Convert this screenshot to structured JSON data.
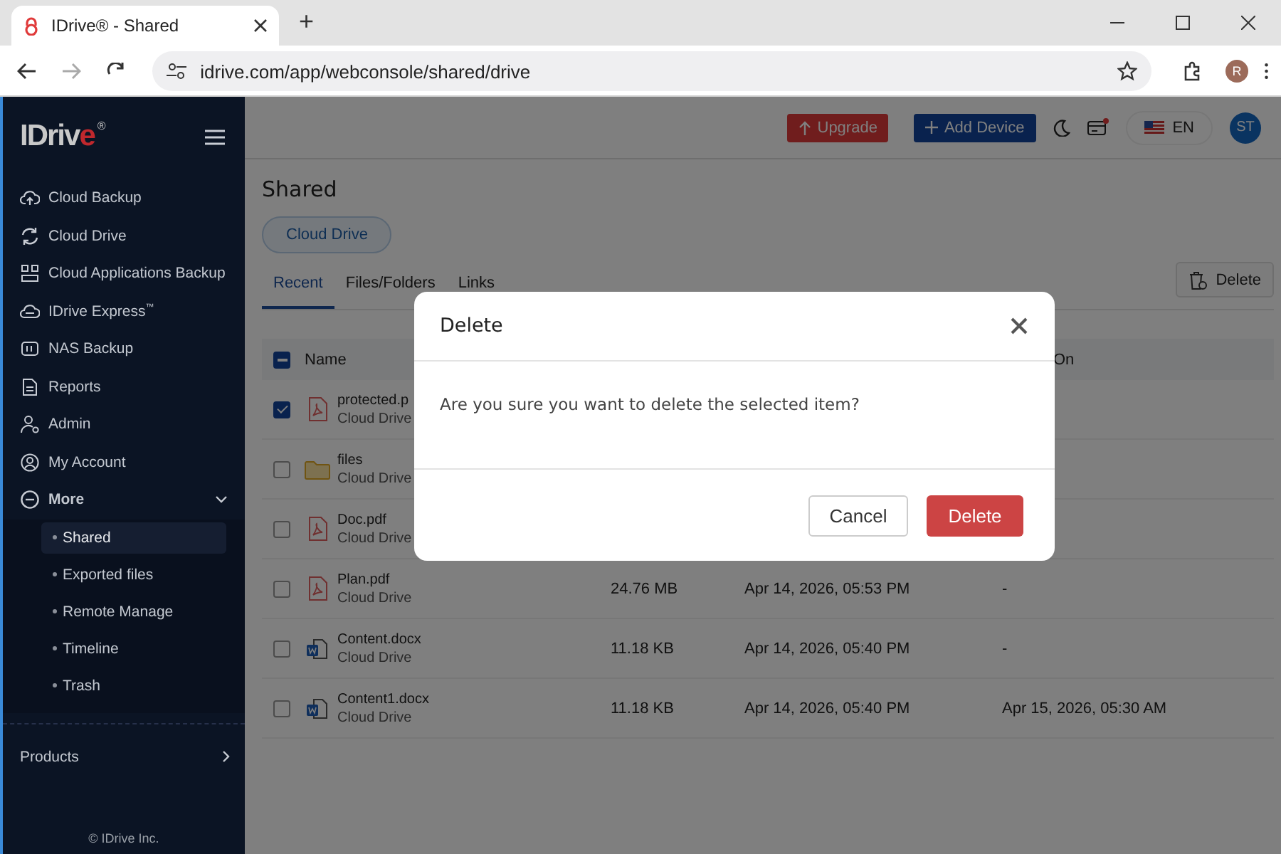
{
  "browser": {
    "tab_title": "IDrive® - Shared",
    "new_tab": "+",
    "url": "idrive.com/app/webconsole/shared/drive",
    "avatar": "R"
  },
  "sidebar": {
    "logo_main": "IDriv",
    "logo_accent": "e",
    "logo_mark": "®",
    "items": [
      {
        "label": "Cloud Backup"
      },
      {
        "label": "Cloud Drive"
      },
      {
        "label": "Cloud Applications Backup"
      },
      {
        "label": "IDrive Express$^{™}$"
      },
      {
        "label": "NAS Backup"
      },
      {
        "label": "Reports"
      },
      {
        "label": "Admin"
      },
      {
        "label": "My Account"
      },
      {
        "label": "More",
        "expanded": true,
        "children": [
          {
            "label": "Shared",
            "selected": true
          },
          {
            "label": "Exported files",
            "selected": false
          },
          {
            "label": "Remote Manage",
            "selected": false
          },
          {
            "label": "Timeline",
            "selected": false
          },
          {
            "label": "Trash",
            "selected": false
          }
        ]
      }
    ],
    "products": "Products",
    "footer": "© IDrive Inc."
  },
  "topbar": {
    "upgrade": "Upgrade",
    "add_device": "Add Device",
    "language": "EN",
    "user": "ST"
  },
  "page": {
    "title": "Shared",
    "filter": "Cloud Drive",
    "delete_button": "Delete",
    "tabs": [
      {
        "label": "Recent",
        "selected": true
      },
      {
        "label": "Files/Folders",
        "selected": false
      },
      {
        "label": "Links",
        "selected": false
      }
    ]
  },
  "table": {
    "header": {
      "indeterminate": true,
      "name": "Name",
      "column_4": "On"
    },
    "rows": [
      {
        "checked": true,
        "kind": "pdf",
        "name": "protected.p",
        "location": "Cloud Drive"
      },
      {
        "checked": false,
        "kind": "folder",
        "name": "files",
        "location": "Cloud Drive"
      },
      {
        "checked": false,
        "kind": "pdf",
        "name": "Doc.pdf",
        "location": "Cloud Drive"
      },
      {
        "checked": false,
        "kind": "pdf",
        "name": "Plan.pdf",
        "location": "Cloud Drive",
        "size": "24.76 MB",
        "date": "Apr 14, 2026, 05:53 PM",
        "modified": "-"
      },
      {
        "checked": false,
        "kind": "docx",
        "name": "Content.docx",
        "location": "Cloud Drive",
        "size": "11.18 KB",
        "date": "Apr 14, 2026, 05:40 PM",
        "modified": "-"
      },
      {
        "checked": false,
        "kind": "docx",
        "name": "Content1.docx",
        "location": "Cloud Drive",
        "size": "11.18 KB",
        "date": "Apr 14, 2026, 05:40 PM",
        "modified": "Apr 15, 2026, 05:30 AM"
      }
    ]
  },
  "dialog": {
    "title": "Delete",
    "message": "Are you sure you want to delete the selected item?",
    "cancel": "Cancel",
    "confirm": "Delete"
  }
}
